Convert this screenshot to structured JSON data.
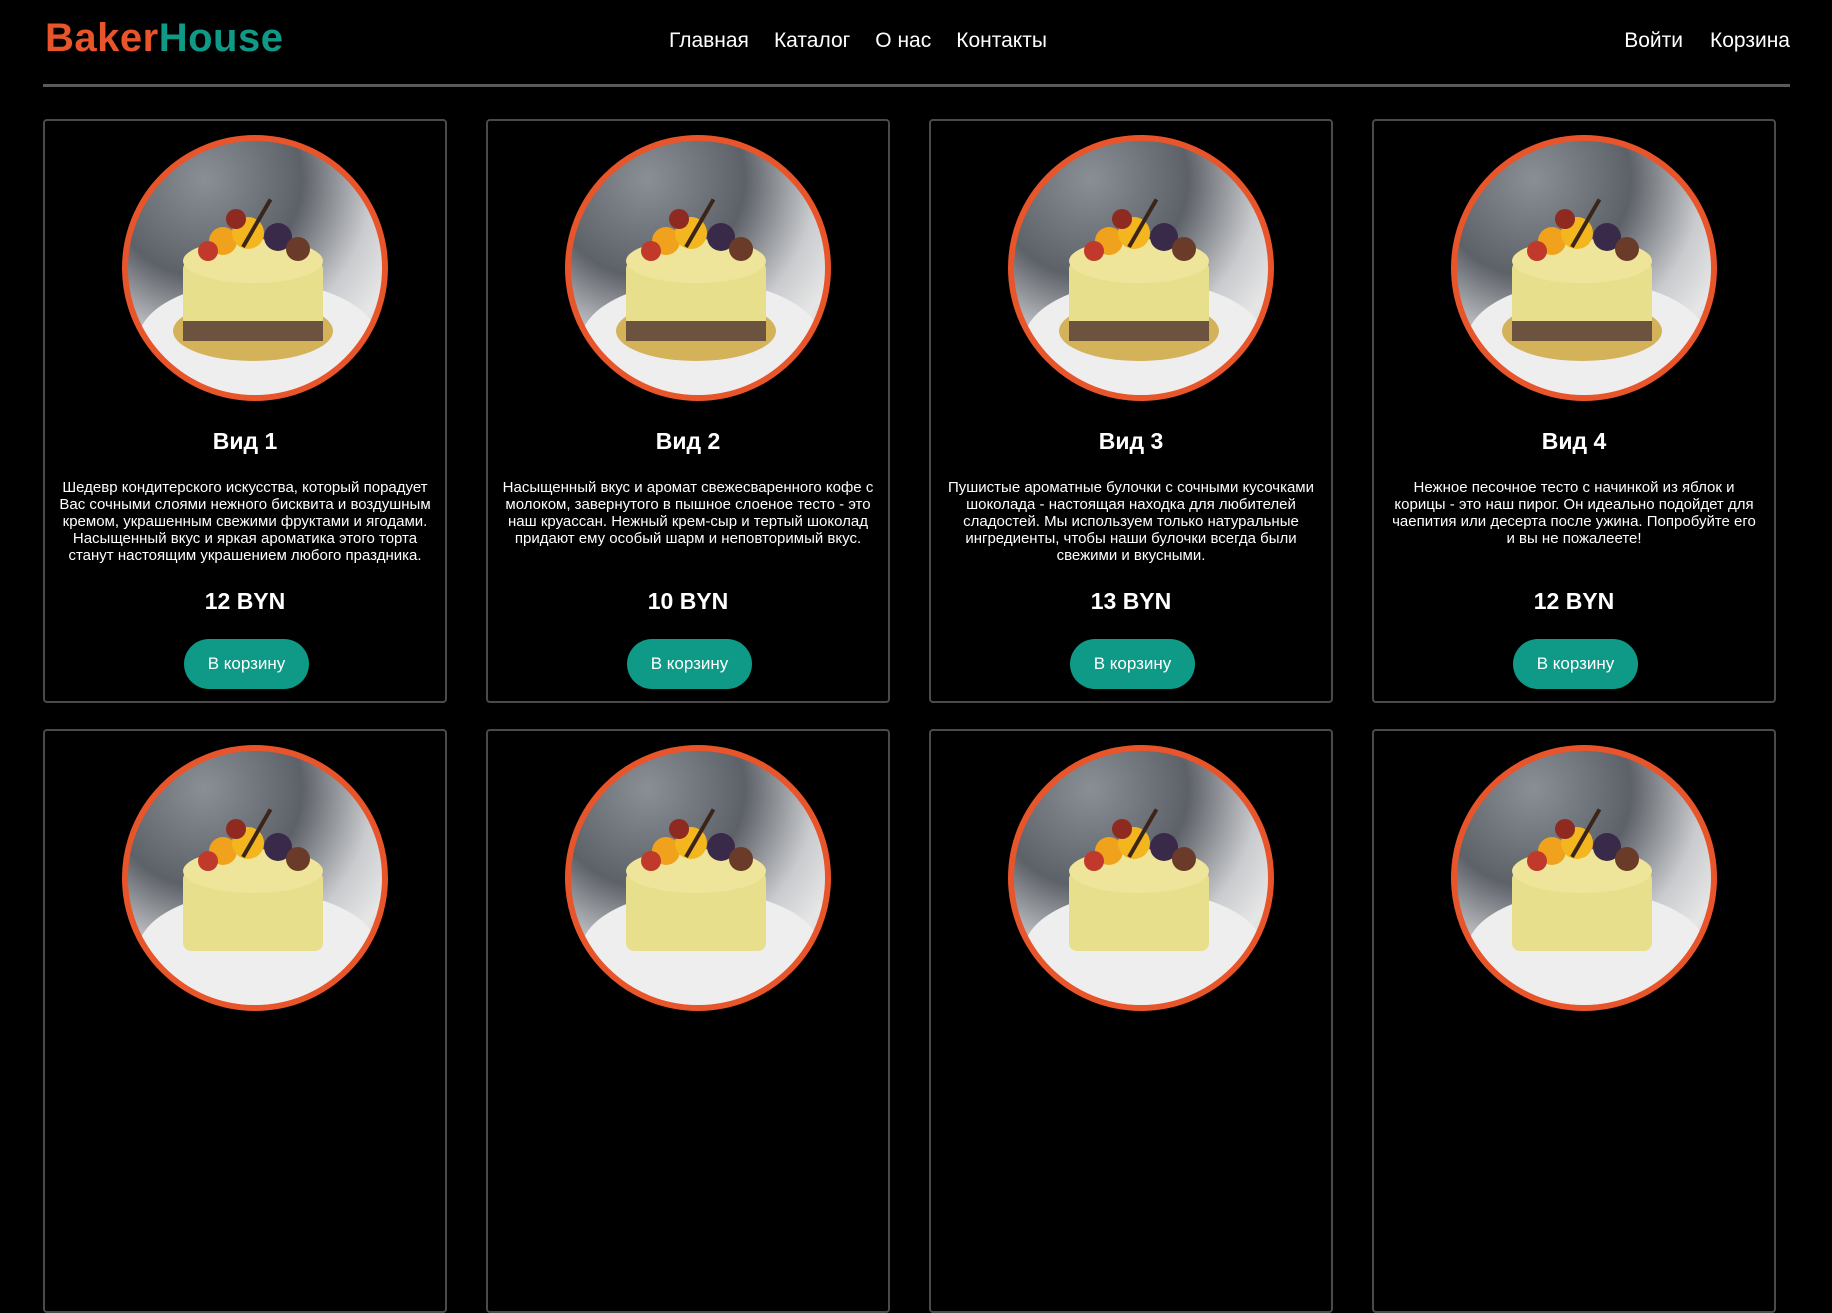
{
  "brand": {
    "part1": "Baker",
    "part2": "House",
    "color1": "#e8552a",
    "color2": "#0e9a86"
  },
  "nav": {
    "items": [
      "Главная",
      "Каталог",
      "О нас",
      "Контакты"
    ]
  },
  "user_nav": {
    "login": "Войти",
    "cart": "Корзина"
  },
  "accent": {
    "button": "#0e9a86",
    "photo_ring": "#e8552a",
    "divider": "#5a5a5a"
  },
  "products": [
    {
      "title": "Вид 1",
      "description": "Шедевр кондитерского искусства, который порадует Вас сочными слоями нежного бисквита и воздушным кремом, украшенным свежими фруктами и ягодами. Насыщенный вкус и яркая ароматика этого торта станут настоящим украшением любого праздника.",
      "price": "12 BYN",
      "button": "В корзину"
    },
    {
      "title": "Вид 2",
      "description": "Насыщенный вкус и аромат свежесваренного кофе с молоком, завернутого в пышное слоеное тесто - это наш круассан. Нежный крем-сыр и тертый шоколад придают ему особый шарм и неповторимый вкус.",
      "price": "10 BYN",
      "button": "В корзину"
    },
    {
      "title": "Вид 3",
      "description": "Пушистые ароматные булочки с сочными кусочками шоколада - настоящая находка для любителей сладостей. Мы используем только натуральные ингредиенты, чтобы наши булочки всегда были свежими и вкусными.",
      "price": "13 BYN",
      "button": "В корзину"
    },
    {
      "title": "Вид 4",
      "description": "Нежное песочное тесто с начинкой из яблок и корицы - это наш пирог. Он идеально подойдет для чаепития или десерта после ужина. Попробуйте его и вы не пожалеете!",
      "price": "12 BYN",
      "button": "В корзину"
    },
    {
      "title": "",
      "description": "",
      "price": "",
      "button": ""
    },
    {
      "title": "",
      "description": "",
      "price": "",
      "button": ""
    },
    {
      "title": "",
      "description": "",
      "price": "",
      "button": ""
    },
    {
      "title": "",
      "description": "",
      "price": "",
      "button": ""
    }
  ]
}
